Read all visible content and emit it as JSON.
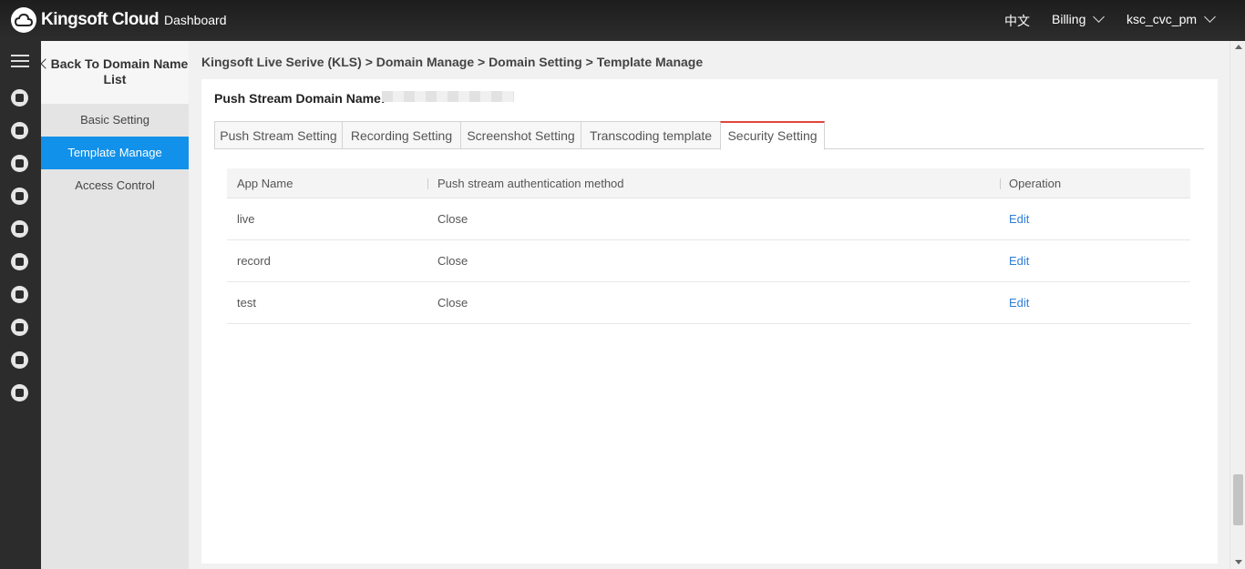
{
  "topbar": {
    "logo_text": "Kingsoft Cloud",
    "dashboard": "Dashboard",
    "language": "中文",
    "billing": "Billing",
    "user": "ksc_cvc_pm"
  },
  "rail": {
    "icons": [
      "cloud-icon",
      "server-icon",
      "network-icon",
      "database-icon",
      "monitor-icon",
      "nodes-icon",
      "cdn-icon",
      "storage-icon",
      "upload-cloud-icon",
      "document-icon"
    ]
  },
  "subnav": {
    "back_label": "Back To Domain Name List",
    "items": [
      {
        "label": "Basic Setting",
        "active": false
      },
      {
        "label": "Template Manage",
        "active": true
      },
      {
        "label": "Access Control",
        "active": false
      }
    ]
  },
  "breadcrumb": "Kingsoft Live Serive (KLS) > Domain Manage > Domain Setting > Template Manage",
  "domain": {
    "label": "Push Stream Domain Name:"
  },
  "tabs": [
    {
      "label": "Push Stream Setting",
      "active": false
    },
    {
      "label": "Recording Setting",
      "active": false
    },
    {
      "label": "Screenshot Setting",
      "active": false
    },
    {
      "label": "Transcoding template",
      "active": false
    },
    {
      "label": "Security Setting",
      "active": true
    }
  ],
  "table": {
    "columns": [
      "App Name",
      "Push stream authentication method",
      "Operation"
    ],
    "rows": [
      {
        "app": "live",
        "method": "Close",
        "op": "Edit"
      },
      {
        "app": "record",
        "method": "Close",
        "op": "Edit"
      },
      {
        "app": "test",
        "method": "Close",
        "op": "Edit"
      }
    ]
  }
}
